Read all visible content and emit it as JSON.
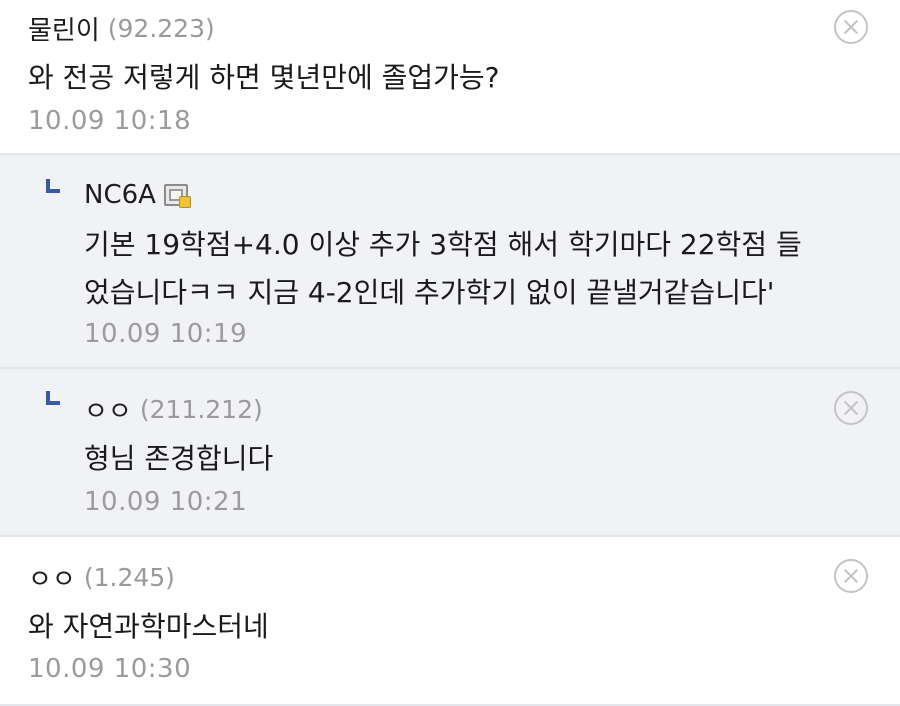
{
  "comments": [
    {
      "nickname": "물린이",
      "ip": "(92.223)",
      "text": "와 전공 저렇게 하면 몇년만에 졸업가능?",
      "date": "10.09 10:18",
      "is_reply": false
    },
    {
      "nickname": "NC6A",
      "ip": "",
      "text_lines": [
        "기본 19학점+4.0 이상 추가 3학점 해서 학기마다 22학점 들",
        "었습니다ㅋㅋ 지금 4-2인데 추가학기 없이 끝낼거같습니다'"
      ],
      "date": "10.09 10:19",
      "is_reply": true,
      "fixed_nick_icon": "fixed-nickname-icon"
    },
    {
      "nickname": "ㅇㅇ",
      "ip": "(211.212)",
      "text": "형님 존경합니다",
      "date": "10.09 10:21",
      "is_reply": true
    },
    {
      "nickname": "ㅇㅇ",
      "ip": "(1.245)",
      "text": "와 자연과학마스터네",
      "date": "10.09 10:30",
      "is_reply": false
    }
  ],
  "colors": {
    "reply_background": "#f1f2f5",
    "divider": "#e3e6ec",
    "reply_arrow": "#3a5aa8",
    "meta_gray": "#9b9b9b"
  }
}
